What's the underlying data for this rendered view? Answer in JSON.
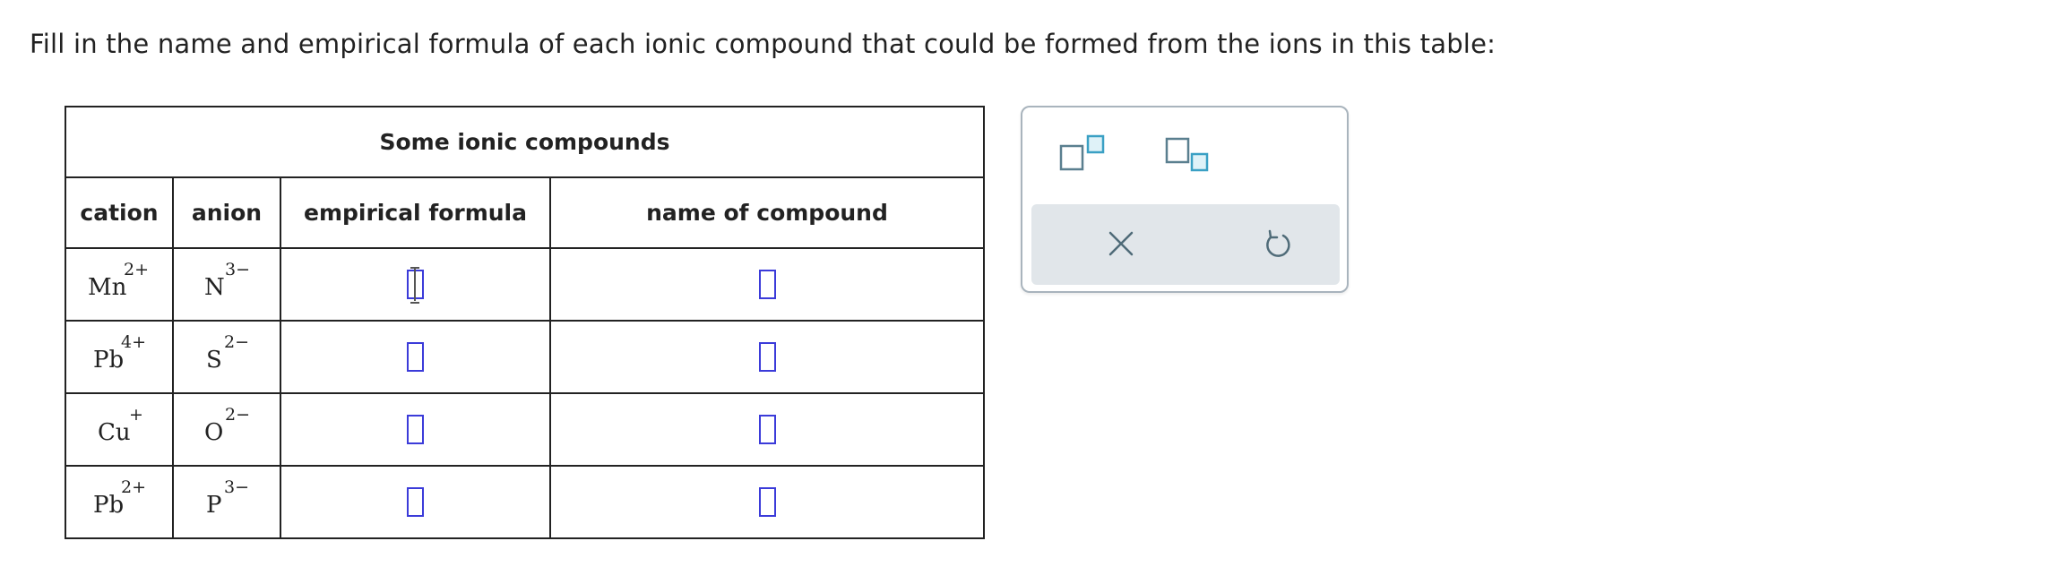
{
  "instruction": "Fill in the name and empirical formula of each ionic compound that could be formed from the ions in this table:",
  "table": {
    "caption": "Some ionic compounds",
    "headers": {
      "cation": "cation",
      "anion": "anion",
      "formula": "empirical formula",
      "name": "name of compound"
    },
    "rows": [
      {
        "cation": "Mn",
        "cation_charge": "2+",
        "anion": "N",
        "anion_charge": "3−",
        "formula": "",
        "name": ""
      },
      {
        "cation": "Pb",
        "cation_charge": "4+",
        "anion": "S",
        "anion_charge": "2−",
        "formula": "",
        "name": ""
      },
      {
        "cation": "Cu",
        "cation_charge": "+",
        "anion": "O",
        "anion_charge": "2−",
        "formula": "",
        "name": ""
      },
      {
        "cation": "Pb",
        "cation_charge": "2+",
        "anion": "P",
        "anion_charge": "3−",
        "formula": "",
        "name": ""
      }
    ]
  },
  "palette": {
    "buttons": [
      {
        "icon": "superscript-icon"
      },
      {
        "icon": "subscript-icon"
      },
      {
        "icon": "close-icon"
      },
      {
        "icon": "undo-icon"
      }
    ]
  },
  "colors": {
    "answer_box": "#3b3bd9",
    "palette_bar": "#e1e6ea",
    "palette_icon": "#5a7f8f",
    "palette_accent": "#3aa0c4"
  }
}
